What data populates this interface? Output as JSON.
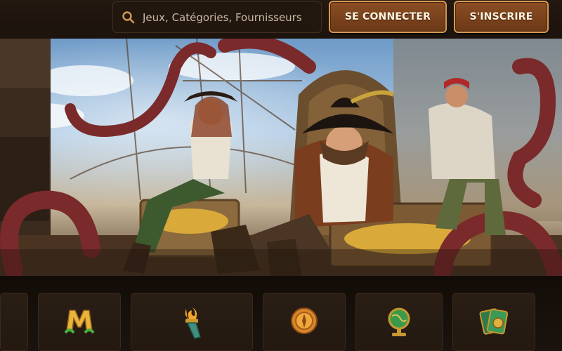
{
  "header": {
    "search": {
      "placeholder": "Jeux, Catégories, Fournisseurs",
      "icon": "search-icon"
    },
    "login_label": "SE CONNECTER",
    "signup_label": "S'INSCRIRE"
  },
  "colors": {
    "background": "#1a120c",
    "button_fill": "#7a4320",
    "button_border": "#d39a55",
    "accent_gold": "#e0a24a"
  },
  "hero": {
    "scene": "pirate-ship-banner"
  },
  "categories": [
    {
      "icon": "category-icon-partial"
    },
    {
      "icon": "m-emblem-icon"
    },
    {
      "icon": "torch-icon"
    },
    {
      "icon": "coin-icon"
    },
    {
      "icon": "globe-icon"
    },
    {
      "icon": "cards-icon"
    }
  ]
}
